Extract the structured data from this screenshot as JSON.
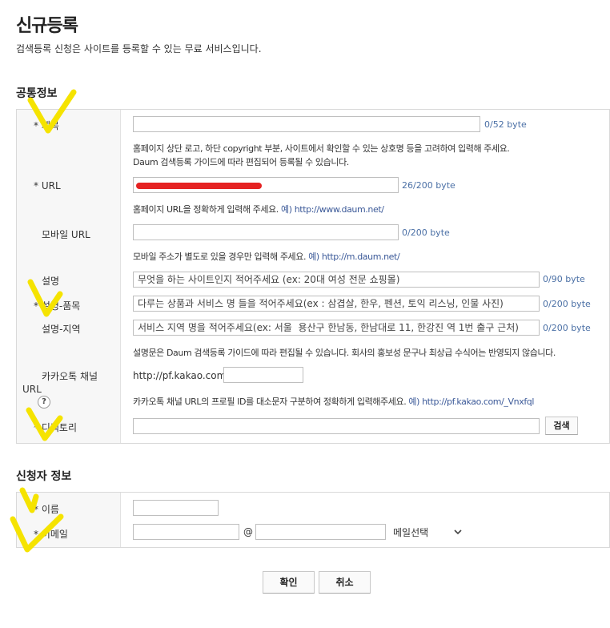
{
  "page": {
    "title": "신규등록",
    "description": "검색등록 신청은 사이트를 등록할 수 있는 무료 서비스입니다."
  },
  "common_section": {
    "title": "공통정보",
    "fields": {
      "title": {
        "label": "제목",
        "required_mark": "*",
        "value": "",
        "byte": "0/52 byte",
        "help1": "홈페이지 상단 로고, 하단 copyright 부분, 사이트에서 확인할 수 있는 상호명 등을 고려하여 입력해 주세요.",
        "help2": "Daum 검색등록 가이드에 따라 편집되어 등록될 수 있습니다."
      },
      "url": {
        "label": "URL",
        "required_mark": "*",
        "value": "",
        "byte": "26/200 byte",
        "help": "홈페이지 URL을 정확하게 입력해 주세요.",
        "example": "예) http://www.daum.net/"
      },
      "mobile_url": {
        "label": "모바일 URL",
        "value": "",
        "byte": "0/200 byte",
        "help": "모바일 주소가 별도로 있을 경우만 입력해 주세요.",
        "example": "예) http://m.daum.net/"
      },
      "desc": {
        "label": "설명",
        "placeholder": "무엇을 하는 사이트인지 적어주세요 (ex: 20대 여성 전문 쇼핑몰)",
        "byte": "0/90 byte"
      },
      "desc_product": {
        "label": "설명-품목",
        "required_mark": "*",
        "placeholder": "다루는 상품과 서비스 명 들을 적어주세요(ex : 삼겹살, 한우, 펜션, 토익 리스닝, 인물 사진)",
        "byte": "0/200 byte"
      },
      "desc_region": {
        "label": "설명-지역",
        "placeholder": "서비스 지역 명을 적어주세요(ex: 서울  용산구 한남동, 한남대로 11, 한강진 역 1번 출구 근처)",
        "byte": "0/200 byte"
      },
      "desc_help": "설명문은 Daum 검색등록 가이드에 따라 편집될 수 있습니다. 회사의 홍보성 문구나 최상급 수식어는 반영되지 않습니다.",
      "kakao": {
        "label_line1": "카카오톡 채널",
        "label_line2": "URL",
        "prefix": "http://pf.kakao.com/",
        "value": "",
        "help_icon": "?",
        "help": "카카오톡 채널 URL의 프로필 ID를 대소문자 구분하여 정확하게 입력해주세요.",
        "example": "예) http://pf.kakao.com/_Vnxfql"
      },
      "directory": {
        "label": "디렉토리",
        "required_mark": "*",
        "value": "",
        "search_button": "검색"
      }
    }
  },
  "applicant_section": {
    "title": "신청자 정보",
    "fields": {
      "name": {
        "label": "이름",
        "required_mark": "*",
        "value": ""
      },
      "email": {
        "label": "이메일",
        "required_mark": "*",
        "local": "",
        "at": "@",
        "domain": "",
        "select_value": "메일선택"
      }
    }
  },
  "buttons": {
    "confirm": "확인",
    "cancel": "취소"
  },
  "icons": {
    "select_arrow": "chevron-down-icon",
    "help": "question-icon"
  },
  "colors": {
    "byte_text": "#4a6fa5",
    "example_link": "#3b5998",
    "redaction": "#e52222",
    "highlight_mark": "#f5e300"
  }
}
